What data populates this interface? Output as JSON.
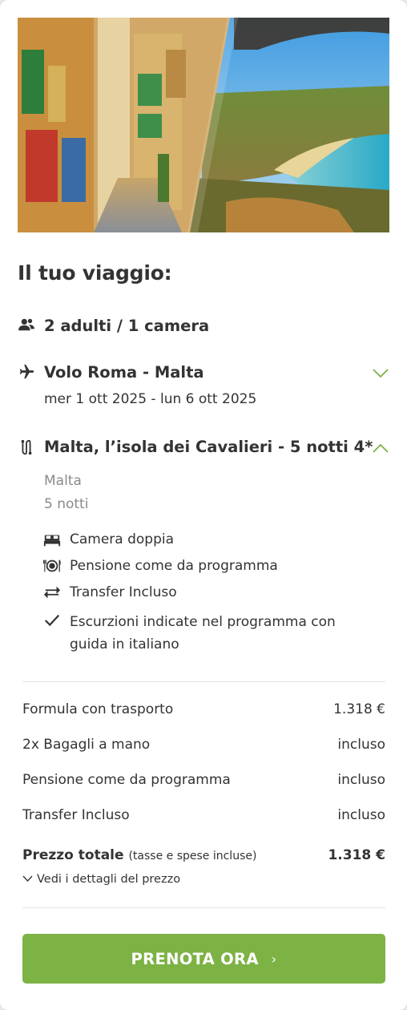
{
  "trip": {
    "title": "Il tuo viaggio:",
    "travellers": "2 adulti / 1 camera",
    "flight": {
      "title": "Volo Roma - Malta",
      "dates": "mer 1 ott 2025 - lun 6 ott 2025"
    },
    "tour": {
      "title": "Malta, l’isola dei Cavalieri - 5 notti 4*",
      "location": "Malta",
      "nights": "5 notti",
      "features": [
        {
          "icon": "bed-icon",
          "label": "Camera doppia"
        },
        {
          "icon": "meal-plate-icon",
          "label": "Pensione come da programma"
        },
        {
          "icon": "transfer-arrows-icon",
          "label": "Transfer Incluso"
        },
        {
          "icon": "check-icon",
          "label": "Escurzioni indicate nel programma con guida in italiano"
        }
      ]
    }
  },
  "pricing": {
    "rows": [
      {
        "label": "Formula con trasporto",
        "value": "1.318 €"
      },
      {
        "label": "2x Bagagli a mano",
        "value": "incluso"
      },
      {
        "label": "Pensione come da programma",
        "value": "incluso"
      },
      {
        "label": "Transfer Incluso",
        "value": "incluso"
      }
    ],
    "total_label": "Prezzo totale",
    "total_note": "(tasse e spese incluse)",
    "total_value": "1.318 €",
    "details_link": "Vedi i dettagli del prezzo"
  },
  "cta": {
    "label": "PRENOTA ORA",
    "arrow": "›"
  },
  "colors": {
    "accent_green": "#7db244",
    "text": "#333333",
    "muted": "#8a8a8a"
  }
}
